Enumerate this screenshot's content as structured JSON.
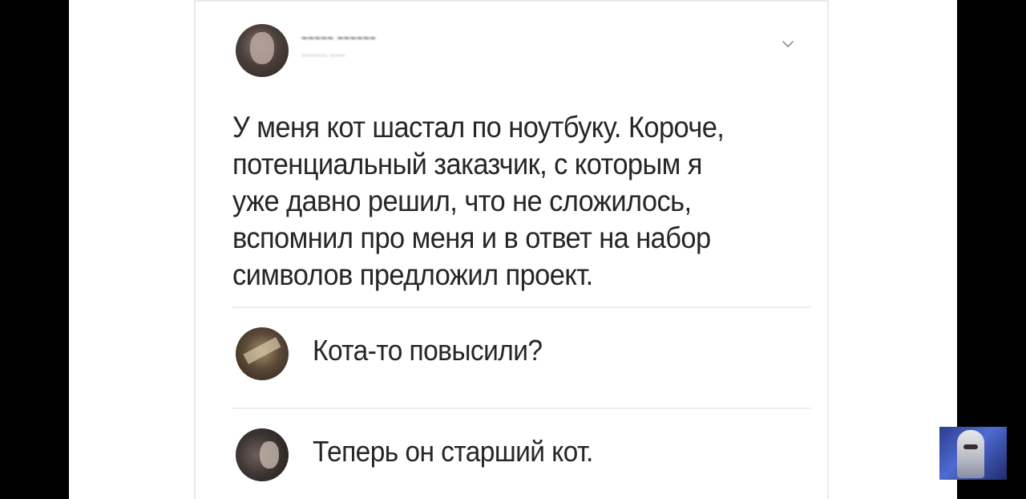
{
  "post": {
    "author_name": "~~~~~ ~~~~~~",
    "author_subline": "~~~~~ ~~~",
    "text_lines": [
      "У меня кот шастал по ноутбуку. Короче,",
      "потенциальный заказчик, с которым я",
      "уже давно решил, что не сложилось,",
      "вспомнил про меня и в ответ на набор",
      "символов предложил проект."
    ]
  },
  "comments": [
    {
      "text": "Кота-то повысили?"
    },
    {
      "text": "Теперь он старший кот."
    }
  ],
  "icons": {
    "menu": "chevron-down-icon"
  },
  "colors": {
    "background": "#000000",
    "card": "#ffffff",
    "text": "#262626",
    "divider": "#ebedf0"
  }
}
